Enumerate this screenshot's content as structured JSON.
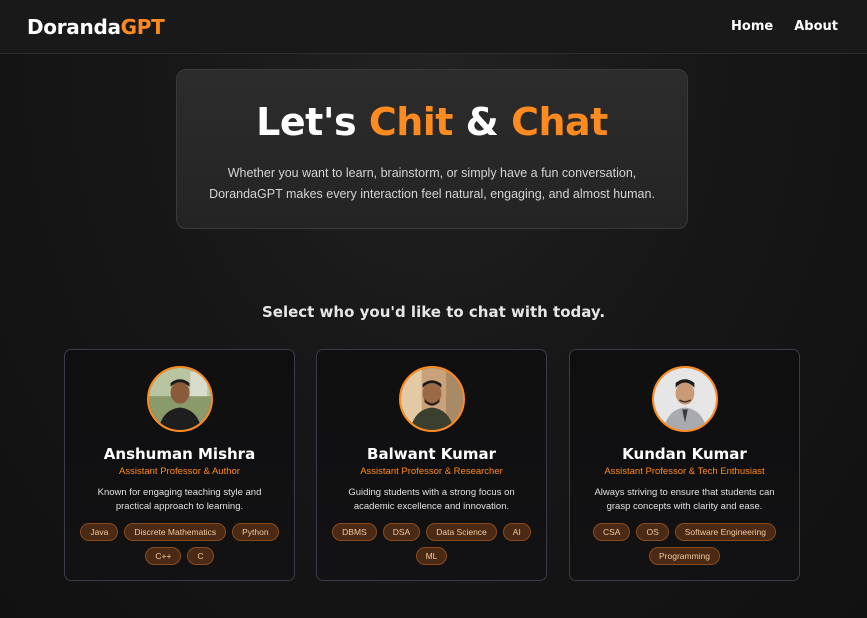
{
  "nav": {
    "brand_main": "Doranda",
    "brand_accent": "GPT",
    "links": [
      "Home",
      "About"
    ]
  },
  "hero": {
    "title_part1": "Let's ",
    "title_accent1": "Chit",
    "title_part2": " & ",
    "title_accent2": "Chat",
    "subtitle": "Whether you want to learn, brainstorm, or simply have a fun conversation, DorandaGPT makes every interaction feel natural, engaging, and almost human."
  },
  "select_heading": "Select who you'd like to chat with today.",
  "cards": [
    {
      "name": "Anshuman Mishra",
      "role": "Assistant Professor & Author",
      "description": "Known for engaging teaching style and practical approach to learning.",
      "tags": [
        "Java",
        "Discrete Mathematics",
        "Python",
        "C++",
        "C"
      ]
    },
    {
      "name": "Balwant Kumar",
      "role": "Assistant Professor & Researcher",
      "description": "Guiding students with a strong focus on academic excellence and innovation.",
      "tags": [
        "DBMS",
        "DSA",
        "Data Science",
        "AI",
        "ML"
      ]
    },
    {
      "name": "Kundan Kumar",
      "role": "Assistant Professor & Tech Enthusiast",
      "description": "Always striving to ensure that students can grasp concepts with clarity and ease.",
      "tags": [
        "CSA",
        "OS",
        "Software Engineering",
        "Programming"
      ]
    }
  ],
  "colors": {
    "accent": "#ff8a1f",
    "background": "#141414",
    "card_border": "#3a3a48",
    "tag_background": "#4a2a14"
  }
}
